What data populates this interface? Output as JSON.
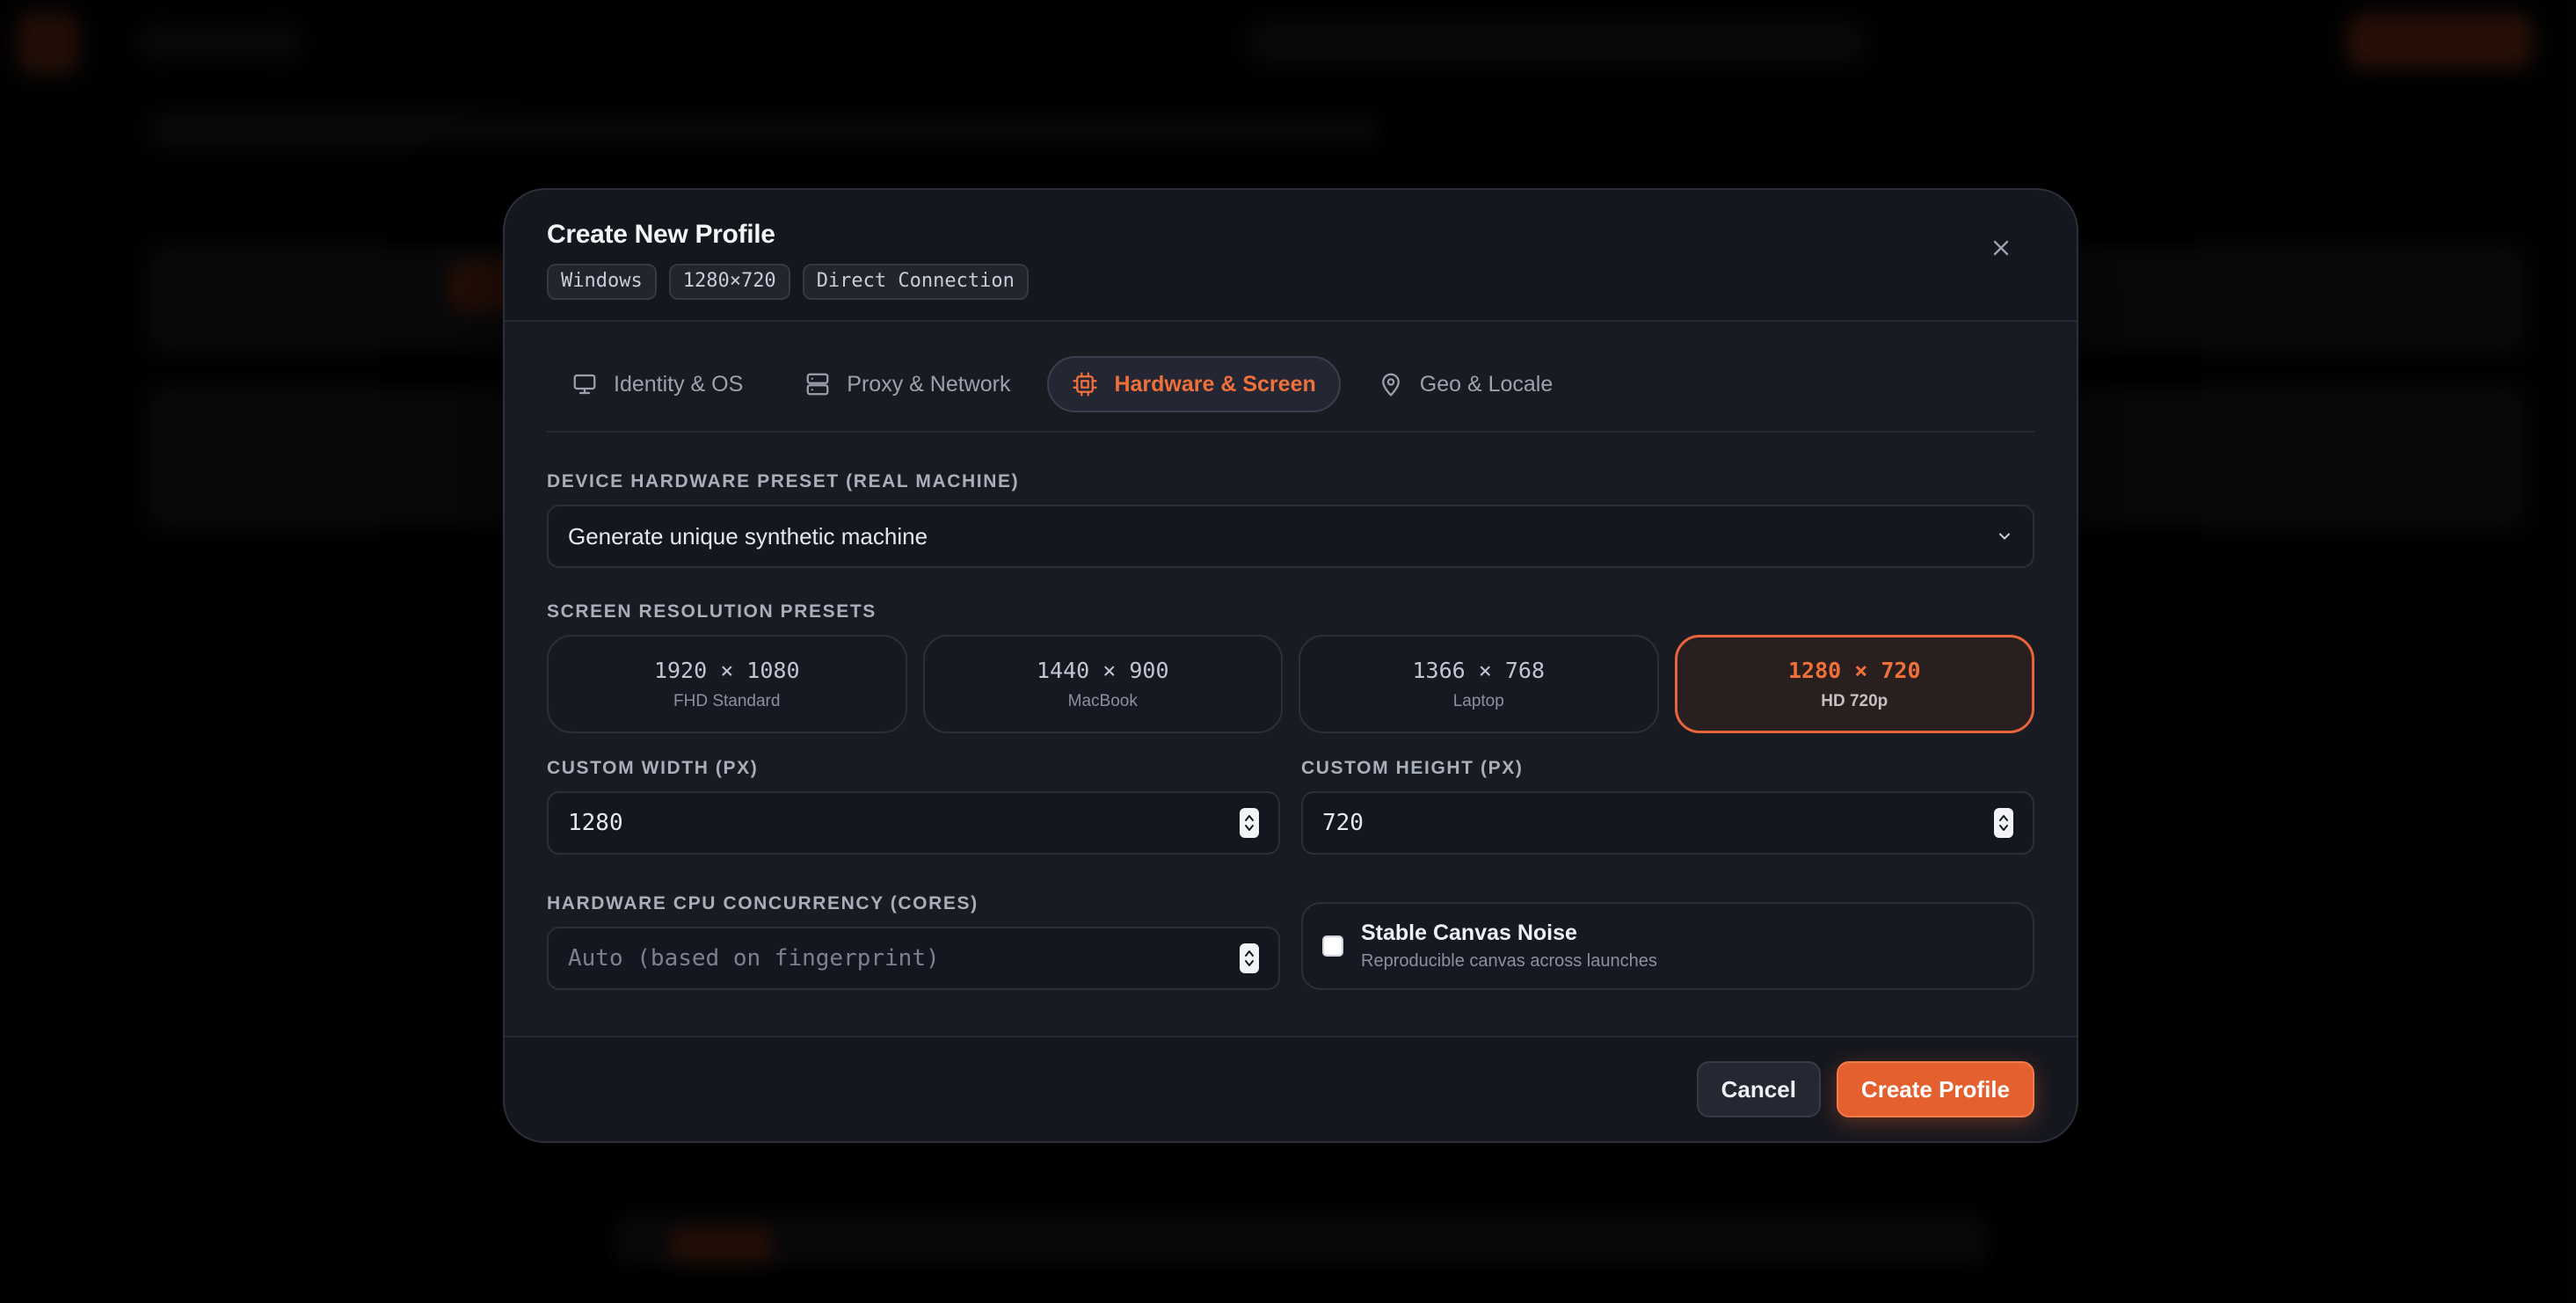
{
  "colors": {
    "accent": "#e4612f",
    "accent_text": "#f0703a",
    "modal_bg": "#15171e",
    "page_bg": "#030304"
  },
  "modal": {
    "title": "Create New Profile",
    "chips": [
      "Windows",
      "1280×720",
      "Direct Connection"
    ],
    "close_icon": "close-icon"
  },
  "tabs": [
    {
      "label": "Identity & OS",
      "icon": "monitor-icon",
      "active": false
    },
    {
      "label": "Proxy & Network",
      "icon": "server-icon",
      "active": false
    },
    {
      "label": "Hardware & Screen",
      "icon": "cpu-icon",
      "active": true
    },
    {
      "label": "Geo & Locale",
      "icon": "map-pin-icon",
      "active": false
    }
  ],
  "hardware_preset": {
    "label": "Device Hardware Preset (Real Machine)",
    "value": "Generate unique synthetic machine"
  },
  "resolution": {
    "label": "Screen Resolution Presets",
    "presets": [
      {
        "value": "1920 × 1080",
        "name": "FHD Standard",
        "selected": false
      },
      {
        "value": "1440 × 900",
        "name": "MacBook",
        "selected": false
      },
      {
        "value": "1366 × 768",
        "name": "Laptop",
        "selected": false
      },
      {
        "value": "1280 × 720",
        "name": "HD 720p",
        "selected": true
      }
    ]
  },
  "custom_width": {
    "label": "Custom Width (px)",
    "value": "1280"
  },
  "custom_height": {
    "label": "Custom Height (px)",
    "value": "720"
  },
  "cpu": {
    "label": "Hardware CPU Concurrency (Cores)",
    "placeholder": "Auto (based on fingerprint)",
    "value": ""
  },
  "canvas_noise": {
    "title": "Stable Canvas Noise",
    "subtitle": "Reproducible canvas across launches",
    "checked": false
  },
  "footer": {
    "cancel_label": "Cancel",
    "create_label": "Create Profile"
  }
}
